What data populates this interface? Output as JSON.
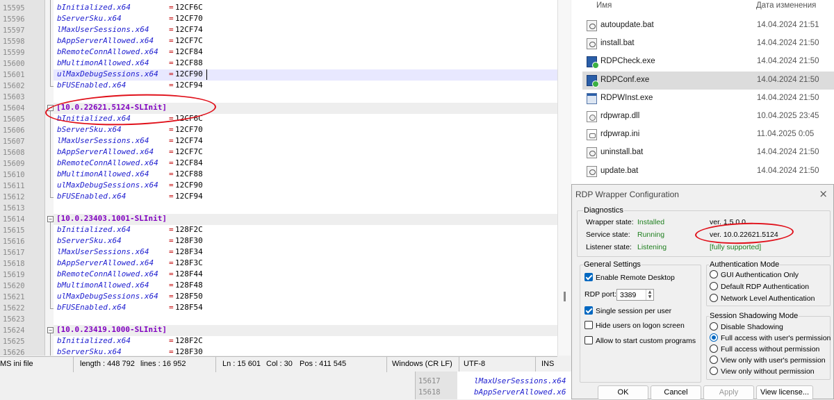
{
  "editor": {
    "rows": [
      {
        "n": "15595",
        "type": "kv",
        "key": "bInitialized.x64",
        "val": "12CF6C"
      },
      {
        "n": "15596",
        "type": "kv",
        "key": "bServerSku.x64",
        "val": "12CF70"
      },
      {
        "n": "15597",
        "type": "kv",
        "key": "lMaxUserSessions.x64",
        "val": "12CF74"
      },
      {
        "n": "15598",
        "type": "kv",
        "key": "bAppServerAllowed.x64",
        "val": "12CF7C"
      },
      {
        "n": "15599",
        "type": "kv",
        "key": "bRemoteConnAllowed.x64",
        "val": "12CF84"
      },
      {
        "n": "15600",
        "type": "kv",
        "key": "bMultimonAllowed.x64",
        "val": "12CF88"
      },
      {
        "n": "15601",
        "type": "kv",
        "key": "ulMaxDebugSessions.x64",
        "val": "12CF90"
      },
      {
        "n": "15602",
        "type": "kv",
        "key": "bFUSEnabled.x64",
        "val": "12CF94"
      },
      {
        "n": "15603",
        "type": "blank"
      },
      {
        "n": "15604",
        "type": "section",
        "key": "[10.0.22621.5124-SLInit]"
      },
      {
        "n": "15605",
        "type": "kv",
        "key": "bInitialized.x64",
        "val": "12CF6C"
      },
      {
        "n": "15606",
        "type": "kv",
        "key": "bServerSku.x64",
        "val": "12CF70"
      },
      {
        "n": "15607",
        "type": "kv",
        "key": "lMaxUserSessions.x64",
        "val": "12CF74"
      },
      {
        "n": "15608",
        "type": "kv",
        "key": "bAppServerAllowed.x64",
        "val": "12CF7C"
      },
      {
        "n": "15609",
        "type": "kv",
        "key": "bRemoteConnAllowed.x64",
        "val": "12CF84"
      },
      {
        "n": "15610",
        "type": "kv",
        "key": "bMultimonAllowed.x64",
        "val": "12CF88"
      },
      {
        "n": "15611",
        "type": "kv",
        "key": "ulMaxDebugSessions.x64",
        "val": "12CF90"
      },
      {
        "n": "15612",
        "type": "kv",
        "key": "bFUSEnabled.x64",
        "val": "12CF94"
      },
      {
        "n": "15613",
        "type": "blank"
      },
      {
        "n": "15614",
        "type": "section",
        "key": "[10.0.23403.1001-SLInit]"
      },
      {
        "n": "15615",
        "type": "kv",
        "key": "bInitialized.x64",
        "val": "128F2C"
      },
      {
        "n": "15616",
        "type": "kv",
        "key": "bServerSku.x64",
        "val": "128F30"
      },
      {
        "n": "15617",
        "type": "kv",
        "key": "lMaxUserSessions.x64",
        "val": "128F34"
      },
      {
        "n": "15618",
        "type": "kv",
        "key": "bAppServerAllowed.x64",
        "val": "128F3C"
      },
      {
        "n": "15619",
        "type": "kv",
        "key": "bRemoteConnAllowed.x64",
        "val": "128F44"
      },
      {
        "n": "15620",
        "type": "kv",
        "key": "bMultimonAllowed.x64",
        "val": "128F48"
      },
      {
        "n": "15621",
        "type": "kv",
        "key": "ulMaxDebugSessions.x64",
        "val": "128F50"
      },
      {
        "n": "15622",
        "type": "kv",
        "key": "bFUSEnabled.x64",
        "val": "128F54"
      },
      {
        "n": "15623",
        "type": "blank"
      },
      {
        "n": "15624",
        "type": "section",
        "key": "[10.0.23419.1000-SLInit]"
      },
      {
        "n": "15625",
        "type": "kv",
        "key": "bInitialized.x64",
        "val": "128F2C"
      },
      {
        "n": "15626",
        "type": "kv",
        "key": "bServerSku.x64",
        "val": "128F30"
      }
    ],
    "current_line": "15601",
    "low_fragment": [
      {
        "n": "15617",
        "key": "lMaxUserSessions.x64"
      },
      {
        "n": "15618",
        "key": "bAppServerAllowed.x6"
      }
    ]
  },
  "statusbar": {
    "filetype": "MS ini file",
    "length": "length : 448 792",
    "lines": "lines : 16 952",
    "ln": "Ln : 15 601",
    "col": "Col : 30",
    "pos": "Pos : 411 545",
    "eol": "Windows (CR LF)",
    "encoding": "UTF-8",
    "mode": "INS"
  },
  "explorer": {
    "col_name": "Имя",
    "col_date": "Дата изменения",
    "files": [
      {
        "name": "autoupdate.bat",
        "date": "14.04.2024 21:51",
        "icon": "bat"
      },
      {
        "name": "install.bat",
        "date": "14.04.2024 21:50",
        "icon": "bat"
      },
      {
        "name": "RDPCheck.exe",
        "date": "14.04.2024 21:50",
        "icon": "exe"
      },
      {
        "name": "RDPConf.exe",
        "date": "14.04.2024 21:50",
        "icon": "exe",
        "selected": true
      },
      {
        "name": "RDPWInst.exe",
        "date": "14.04.2024 21:50",
        "icon": "win"
      },
      {
        "name": "rdpwrap.dll",
        "date": "10.04.2025 23:45",
        "icon": "dll"
      },
      {
        "name": "rdpwrap.ini",
        "date": "11.04.2025 0:05",
        "icon": "ini"
      },
      {
        "name": "uninstall.bat",
        "date": "14.04.2024 21:50",
        "icon": "bat"
      },
      {
        "name": "update.bat",
        "date": "14.04.2024 21:50",
        "icon": "bat"
      }
    ]
  },
  "dialog": {
    "title": "RDP Wrapper Configuration",
    "close": "×",
    "diagnostics": {
      "legend": "Diagnostics",
      "wrapper_label": "Wrapper state:",
      "wrapper_value": "Installed",
      "wrapper_ver": "ver. 1.5.0.0",
      "service_label": "Service state:",
      "service_value": "Running",
      "service_ver": "ver. 10.0.22621.5124",
      "listener_label": "Listener state:",
      "listener_value": "Listening",
      "support": "[fully supported]"
    },
    "general": {
      "legend": "General Settings",
      "enable_rd": "Enable Remote Desktop",
      "rdp_port_label": "RDP port:",
      "rdp_port": "3389",
      "single_session": "Single session per user",
      "hide_users": "Hide users on logon screen",
      "custom_programs": "Allow to start custom programs"
    },
    "auth": {
      "legend": "Authentication Mode",
      "opt1": "GUI Authentication Only",
      "opt2": "Default RDP Authentication",
      "opt3": "Network Level Authentication"
    },
    "shadow": {
      "legend": "Session Shadowing Mode",
      "opt1": "Disable Shadowing",
      "opt2": "Full access with user's permission",
      "opt3": "Full access without permission",
      "opt4": "View only with user's permission",
      "opt5": "View only without permission"
    },
    "buttons": {
      "ok": "OK",
      "cancel": "Cancel",
      "apply": "Apply",
      "license": "View license..."
    }
  }
}
